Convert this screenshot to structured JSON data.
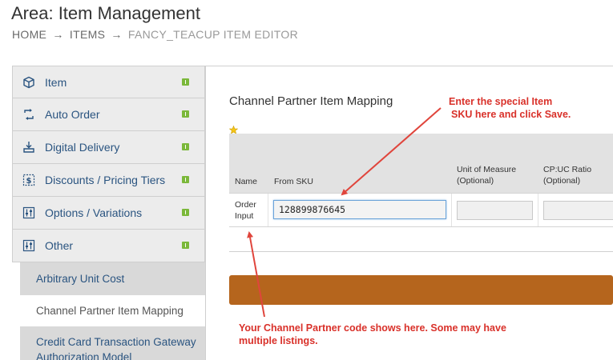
{
  "header": {
    "title": "Area: Item Management",
    "breadcrumb": [
      {
        "label": "HOME"
      },
      {
        "label": "ITEMS"
      },
      {
        "label": "FANCY_TEACUP ITEM EDITOR"
      }
    ],
    "breadcrumb_separator": "→"
  },
  "sidebar": {
    "items": [
      {
        "label": "Item",
        "icon": "cube-icon"
      },
      {
        "label": "Auto Order",
        "icon": "refresh-icon"
      },
      {
        "label": "Digital Delivery",
        "icon": "download-icon"
      },
      {
        "label": "Discounts / Pricing Tiers",
        "icon": "dollar-icon"
      },
      {
        "label": "Options / Variations",
        "icon": "sliders-icon"
      },
      {
        "label": "Other",
        "icon": "sliders-icon"
      }
    ],
    "subitems": [
      {
        "label": "Arbitrary Unit Cost",
        "active": false
      },
      {
        "label": "Channel Partner Item Mapping",
        "active": true
      },
      {
        "label": "Credit Card Transaction Gateway Authorization Model",
        "active": false
      }
    ]
  },
  "main": {
    "section_title": "Channel Partner Item Mapping",
    "table": {
      "headers": {
        "name": "Name",
        "from_sku": "From SKU",
        "uom_line1": "Unit of Measure",
        "uom_line2": "(Optional)",
        "ratio_line1": "CP:UC Ratio",
        "ratio_line2": "(Optional)"
      },
      "rows": [
        {
          "name_line1": "Order",
          "name_line2": "Input",
          "from_sku": "128899876645",
          "uom": "",
          "ratio": ""
        }
      ]
    }
  },
  "annotations": {
    "top_line1": "Enter the special Item",
    "top_line2": "SKU here and click Save.",
    "bottom_line1": "Your Channel Partner code shows here.  Some may have",
    "bottom_line2": "multiple listings."
  },
  "colors": {
    "save_bar": "#b5651d",
    "annotation": "#d9312a",
    "badge": "#7bb83a",
    "link": "#2a5480"
  }
}
